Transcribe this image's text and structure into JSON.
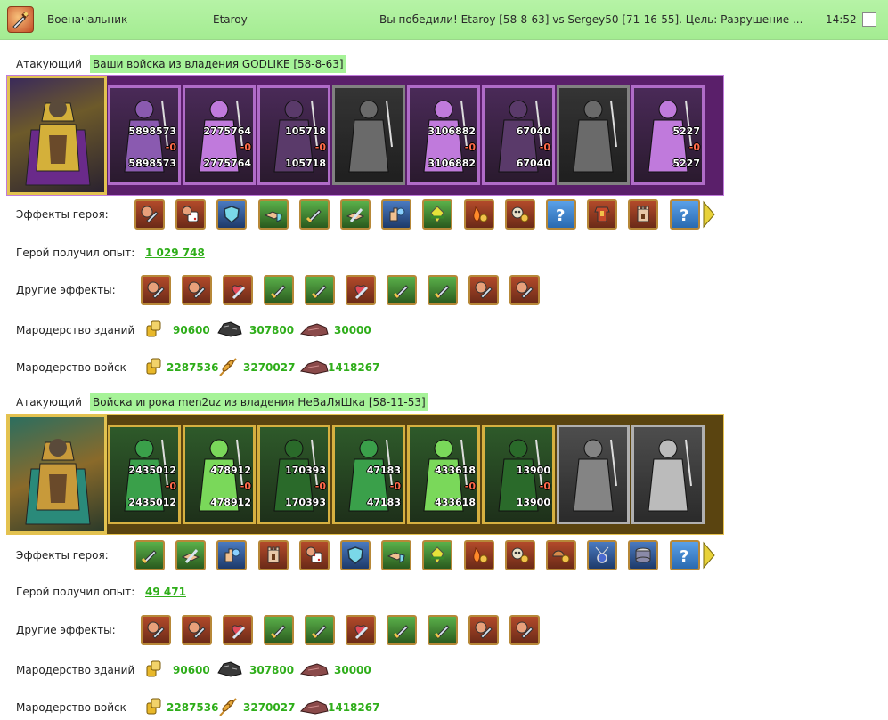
{
  "header": {
    "role": "Военачальник",
    "player": "Etaroy",
    "result": "Вы победили! Etaroy [58-8-63] vs Sergey50 [71-16-55]. Цель: Разрушение ...",
    "time": "14:52"
  },
  "blocks": [
    {
      "attacker_label": "Атакующий",
      "army_name": "Ваши войска из владения GODLIKE [58-8-63]",
      "strip_theme": "purple",
      "units": [
        {
          "top": "5898573",
          "loss": "-0",
          "bottom": "5898573",
          "grey": false
        },
        {
          "top": "2775764",
          "loss": "-0",
          "bottom": "2775764",
          "grey": false
        },
        {
          "top": "105718",
          "loss": "-0",
          "bottom": "105718",
          "grey": false
        },
        {
          "top": "",
          "loss": "",
          "bottom": "",
          "grey": true
        },
        {
          "top": "3106882",
          "loss": "-0",
          "bottom": "3106882",
          "grey": false
        },
        {
          "top": "67040",
          "loss": "-0",
          "bottom": "67040",
          "grey": false
        },
        {
          "top": "",
          "loss": "",
          "bottom": "",
          "grey": true
        },
        {
          "top": "5227",
          "loss": "-0",
          "bottom": "5227",
          "grey": false
        }
      ],
      "hero_effects_label": "Эффекты героя:",
      "hero_effects": [
        "fist-sword-icon",
        "dice-fist-icon",
        "shield-icon",
        "handshake-shield-icon",
        "sword-icon",
        "handshake-sword-icon",
        "hand-magic-icon",
        "crystal-icon",
        "fire-coin-icon",
        "skull-coin-icon",
        "question-icon",
        "armor-icon",
        "tower-icon",
        "question-icon"
      ],
      "xp_label": "Герой получил опыт:",
      "xp_value": "1 029 748",
      "other_effects_label": "Другие эффекты:",
      "other_effects": [
        "fist-sword-icon",
        "fist-sword-icon",
        "heart-sword-icon",
        "sword-icon",
        "sword-icon",
        "heart-sword-icon",
        "sword-icon",
        "sword-icon",
        "fist-sword-icon",
        "fist-sword-icon"
      ],
      "loot_buildings_label": "Мародерство зданий",
      "loot_buildings": [
        {
          "icon": "gold-coins-icon",
          "value": "90600"
        },
        {
          "icon": "ore-icon",
          "value": "307800"
        },
        {
          "icon": "stone-icon",
          "value": "30000"
        }
      ],
      "loot_troops_label": "Мародерство войск",
      "loot_troops": [
        {
          "icon": "gold-coins-icon",
          "value": "2287536"
        },
        {
          "icon": "wheat-icon",
          "value": "3270027"
        },
        {
          "icon": "stone-icon",
          "value": "1418267"
        }
      ]
    },
    {
      "attacker_label": "Атакующий",
      "army_name": "Войска игрока men2uz из владения НеВаЛяШка [58-11-53]",
      "strip_theme": "gold",
      "units": [
        {
          "top": "2435012",
          "loss": "-0",
          "bottom": "2435012",
          "grey": false
        },
        {
          "top": "478912",
          "loss": "-0",
          "bottom": "478912",
          "grey": false
        },
        {
          "top": "170393",
          "loss": "-0",
          "bottom": "170393",
          "grey": false
        },
        {
          "top": "47183",
          "loss": "-0",
          "bottom": "47183",
          "grey": false
        },
        {
          "top": "433618",
          "loss": "-0",
          "bottom": "433618",
          "grey": false
        },
        {
          "top": "13900",
          "loss": "-0",
          "bottom": "13900",
          "grey": false
        },
        {
          "top": "",
          "loss": "",
          "bottom": "",
          "grey": true
        },
        {
          "top": "",
          "loss": "",
          "bottom": "",
          "grey": true
        }
      ],
      "hero_effects_label": "Эффекты героя:",
      "hero_effects": [
        "sword-icon",
        "handshake-sword-icon",
        "hand-magic-icon",
        "tower-icon",
        "dice-fist-icon",
        "shield-icon",
        "handshake-shield-icon",
        "crystal-icon",
        "fire-coin-icon",
        "skull-coin-icon",
        "helmet-coin-icon",
        "amulet-icon",
        "drum-icon",
        "question-icon"
      ],
      "xp_label": "Герой получил опыт:",
      "xp_value": "49 471",
      "other_effects_label": "Другие эффекты:",
      "other_effects": [
        "fist-sword-icon",
        "fist-sword-icon",
        "heart-sword-icon",
        "sword-icon",
        "sword-icon",
        "heart-sword-icon",
        "sword-icon",
        "sword-icon",
        "fist-sword-icon",
        "fist-sword-icon"
      ],
      "loot_buildings_label": "Мародерство зданий",
      "loot_buildings": [
        {
          "icon": "gold-coins-icon",
          "value": "90600"
        },
        {
          "icon": "ore-icon",
          "value": "307800"
        },
        {
          "icon": "stone-icon",
          "value": "30000"
        }
      ],
      "loot_troops_label": "Мародерство войск",
      "loot_troops": [
        {
          "icon": "gold-coins-icon",
          "value": "2287536"
        },
        {
          "icon": "wheat-icon",
          "value": "3270027"
        },
        {
          "icon": "stone-icon",
          "value": "1418267"
        }
      ]
    }
  ]
}
